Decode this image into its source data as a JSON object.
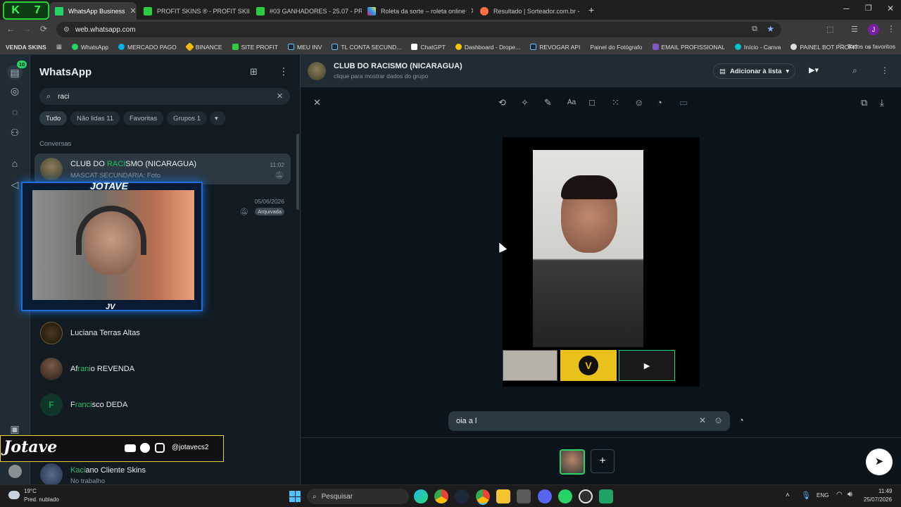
{
  "browser": {
    "tabs": [
      {
        "label": "WhatsApp Business",
        "active": true,
        "color": "#25d366"
      },
      {
        "label": "PROFIT SKINS ® - PROFIT SKIN",
        "active": false,
        "color": "#2ecc40"
      },
      {
        "label": "#03 GANHADORES - 25.07 - PR",
        "active": false,
        "color": "#2ecc40"
      },
      {
        "label": "Roleta da sorte – roleta online",
        "active": false,
        "color": "#e91e63"
      },
      {
        "label": "Resultado | Sorteador.com.br -",
        "active": false,
        "color": "#ff7043"
      }
    ],
    "url": "web.whatsapp.com",
    "bookmarks": [
      "VENDA SKINS",
      "WhatsApp",
      "MERCADO PAGO",
      "BINANCE",
      "SITE PROFIT",
      "MEU INV",
      "TL CONTA SECUND...",
      "ChatGPT",
      "Dashboard - Drope...",
      "REVOGAR API",
      "Painel do Fotógrafo",
      "EMAIL PROFISSIONAL",
      "Início - Canva",
      "PAINEL BOT PROFIT"
    ],
    "favorites_label": "Todos os favoritos",
    "profile_initial": "J"
  },
  "rail": {
    "badge": "10"
  },
  "sidebar": {
    "title": "WhatsApp",
    "search_value": "raci",
    "chips": [
      "Tudo",
      "Não lidas 11",
      "Favoritas",
      "Grupos 1"
    ],
    "section_label": "Conversas",
    "chats": [
      {
        "name_pre": "CLUB DO ",
        "name_hl": "RACI",
        "name_post": "SMO (NICARAGUA)",
        "sub": "MASCAT SECUNDARIA:  Foto",
        "time": "11:02"
      },
      {
        "name_pre": "",
        "name_hl": "",
        "name_post": "",
        "sub": "",
        "time": "05/06/2026",
        "tag": "Arquivada"
      },
      {
        "name_pre": "Luciana Terras Altas",
        "name_hl": "",
        "name_post": "",
        "sub": "",
        "time": ""
      },
      {
        "name_pre": "Af",
        "name_hl": "rani",
        "name_post": "o REVENDA",
        "sub": "",
        "time": ""
      },
      {
        "name_pre": "F",
        "name_hl": "ranci",
        "name_post": "sco DEDA",
        "sub": "",
        "time": "",
        "initial": "F"
      },
      {
        "name_pre": "",
        "name_hl": "Kaci",
        "name_post": "ano Cliente Skins",
        "sub": "No trabalho",
        "time": ""
      }
    ]
  },
  "chat_header": {
    "title": "CLUB DO RACISMO (NICARAGUA)",
    "subtitle": "clique para mostrar dados do grupo",
    "add_list": "Adicionar à lista"
  },
  "composer": {
    "value": "oia a l"
  },
  "overlay": {
    "logo": "JOTAVE",
    "bottom_brand": "Jotave",
    "handle": "@jotavecs2",
    "tag": "JV"
  },
  "taskbar": {
    "weather_temp": "19°C",
    "weather_desc": "Pred. nublado",
    "search": "Pesquisar",
    "lang": "ENG",
    "time": "11:49",
    "date": "25/07/2026"
  }
}
